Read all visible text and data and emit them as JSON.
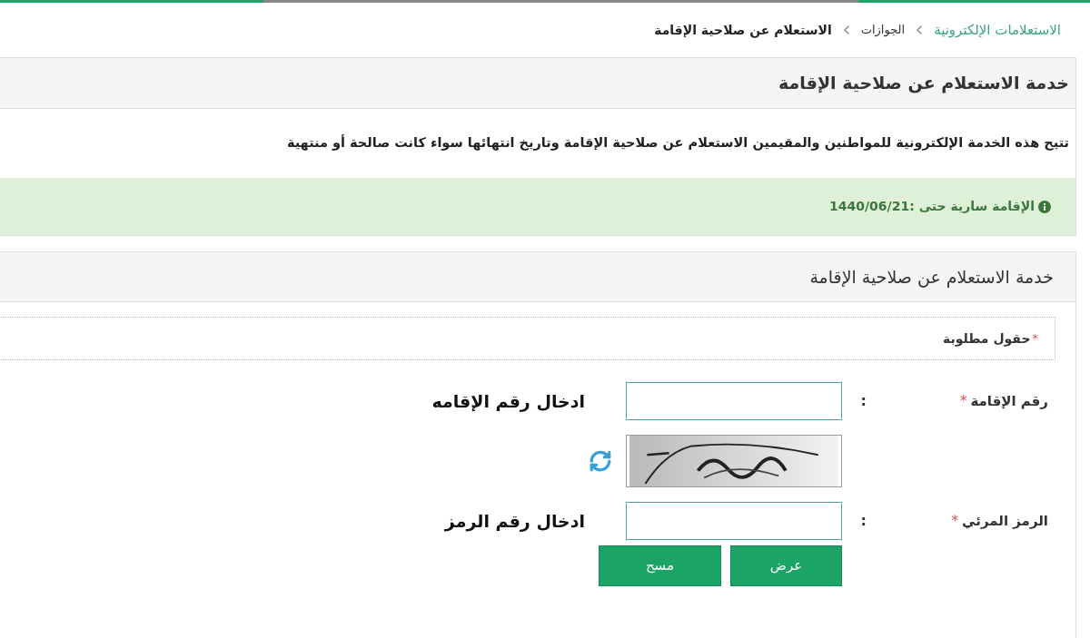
{
  "breadcrumb": [
    {
      "label": "الاستعلامات الإلكترونية",
      "kind": "link"
    },
    {
      "label": "الجوازات",
      "kind": "link"
    },
    {
      "label": "الاستعلام عن صلاحية الإقامة",
      "kind": "current"
    }
  ],
  "service_panel": {
    "title": "خدمة الاستعلام عن صلاحية الإقامة",
    "description": "تتيح هذه الخدمة الإلكترونية للمواطنين والمقيمين الاستعلام عن صلاحية الإقامة وتاريخ انتهائها سواء كانت صالحة أو منتهية"
  },
  "alert": {
    "text": "الإقامة سارية حتى :1440/06/21"
  },
  "form_panel": {
    "title": "خدمة الاستعلام عن صلاحية الإقامة",
    "required_mark": "*",
    "required_note": "حقول مطلوبة",
    "fields": [
      {
        "kind": "text",
        "label": "رقم الإقامة",
        "required_mark": "*",
        "separator": ":",
        "annotation": "ادخال رقم الإقامه"
      },
      {
        "kind": "captcha"
      },
      {
        "kind": "text",
        "label": "الرمز المرئي",
        "required_mark": "*",
        "separator": ":",
        "annotation": "ادخال رقم الرمز"
      }
    ],
    "buttons": [
      {
        "label": "عرض"
      },
      {
        "label": "مسح"
      }
    ]
  }
}
